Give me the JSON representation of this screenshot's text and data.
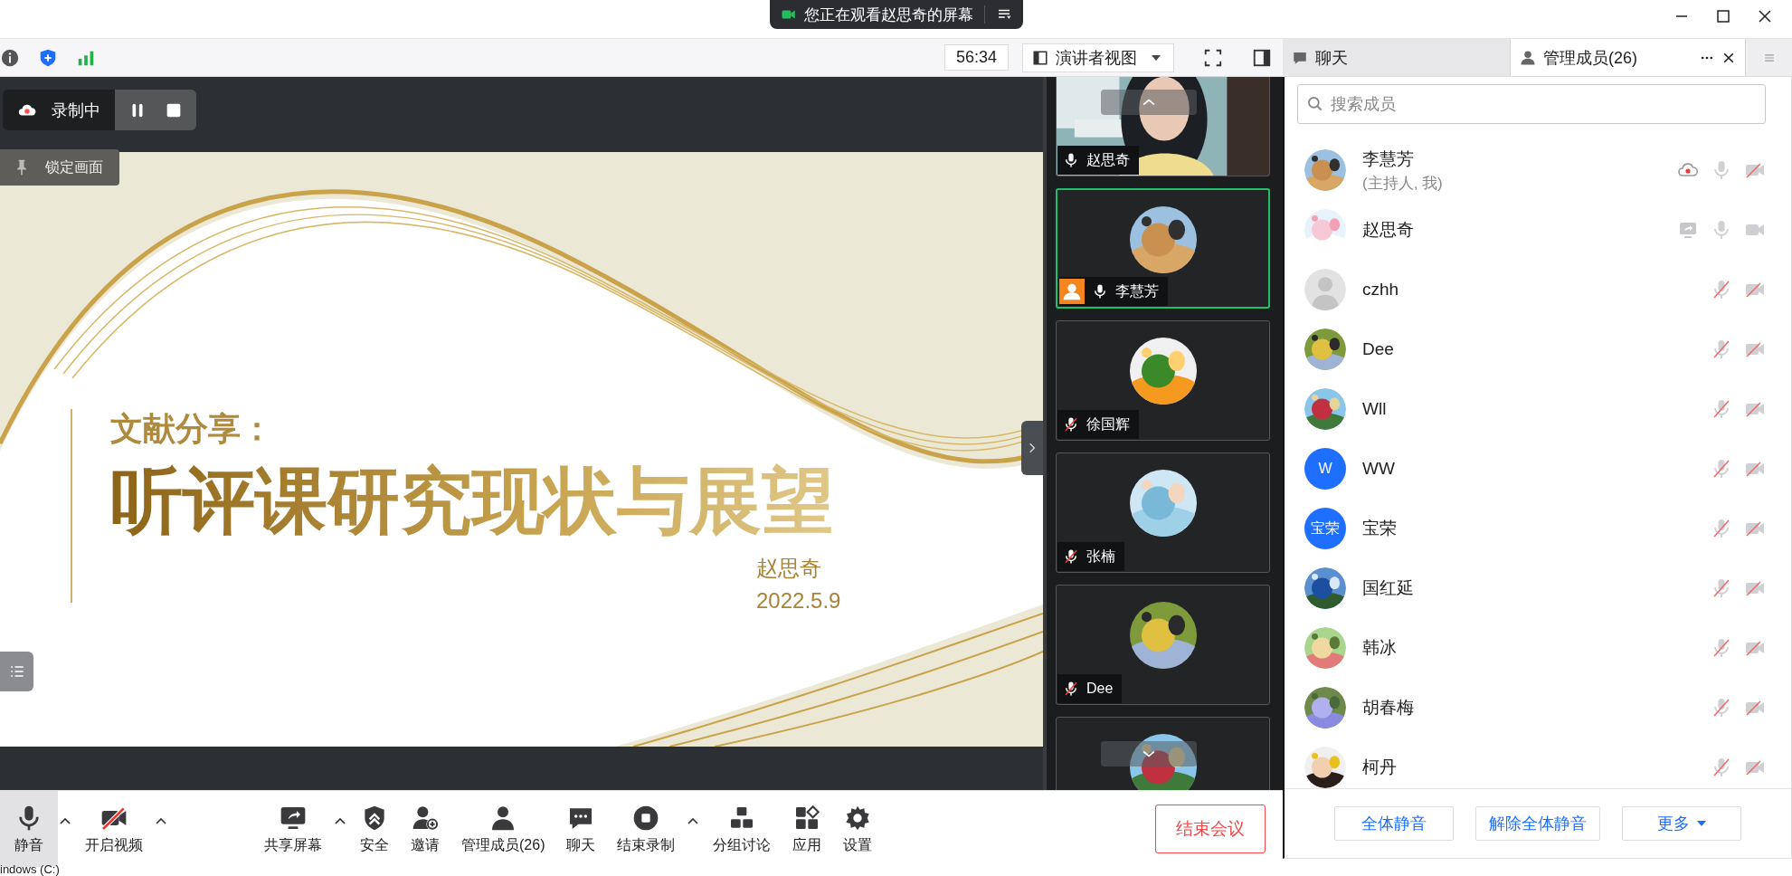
{
  "window": {
    "banner": "您正在观看赵思奇的屏幕"
  },
  "toolbar": {
    "timer": "56:34",
    "view_mode": "演讲者视图"
  },
  "side_tabs": [
    {
      "label": "聊天",
      "selected": false
    },
    {
      "label": "管理成员(26)",
      "selected": true
    }
  ],
  "recording": {
    "label": "录制中"
  },
  "lock_view": {
    "label": "锁定画面"
  },
  "slide": {
    "subtitle": "文献分享：",
    "title": "听评课研究现状与展望",
    "author": "赵思奇",
    "date": "2022.5.9"
  },
  "video_tiles": [
    {
      "kind": "camera",
      "name": "赵思奇",
      "mic_muted": false,
      "host": false,
      "selected": false
    },
    {
      "kind": "avatar",
      "name": "李慧芳",
      "mic_muted": false,
      "host": true,
      "selected": true
    },
    {
      "kind": "avatar",
      "name": "徐国辉",
      "mic_muted": true,
      "host": false,
      "selected": false
    },
    {
      "kind": "avatar",
      "name": "张楠",
      "mic_muted": true,
      "host": false,
      "selected": false
    },
    {
      "kind": "avatar",
      "name": "Dee",
      "mic_muted": true,
      "host": false,
      "selected": false
    },
    {
      "kind": "avatar",
      "selected": false
    }
  ],
  "members": {
    "search_placeholder": "搜索成员",
    "items": [
      {
        "name": "李慧芳",
        "role": "(主持人, 我)",
        "kind": "picture",
        "recording": true,
        "sharing": false,
        "mic_muted": false,
        "camera_off": true
      },
      {
        "name": "赵思奇",
        "kind": "picture",
        "recording": false,
        "sharing": true,
        "mic_muted": false,
        "camera_off": false
      },
      {
        "name": "czhh",
        "kind": "default",
        "recording": false,
        "sharing": false,
        "mic_muted": true,
        "camera_off": true
      },
      {
        "name": "Dee",
        "kind": "picture",
        "recording": false,
        "sharing": false,
        "mic_muted": true,
        "camera_off": true
      },
      {
        "name": "Wll",
        "kind": "picture",
        "recording": false,
        "sharing": false,
        "mic_muted": true,
        "camera_off": true
      },
      {
        "name": "WW",
        "kind": "initials",
        "initials": "W",
        "recording": false,
        "sharing": false,
        "mic_muted": true,
        "camera_off": true
      },
      {
        "name": "宝荣",
        "kind": "initials",
        "initials": "宝荣",
        "recording": false,
        "sharing": false,
        "mic_muted": true,
        "camera_off": true
      },
      {
        "name": "国红延",
        "kind": "picture",
        "recording": false,
        "sharing": false,
        "mic_muted": true,
        "camera_off": true
      },
      {
        "name": "韩冰",
        "kind": "picture",
        "recording": false,
        "sharing": false,
        "mic_muted": true,
        "camera_off": true
      },
      {
        "name": "胡春梅",
        "kind": "picture",
        "recording": false,
        "sharing": false,
        "mic_muted": true,
        "camera_off": true
      },
      {
        "name": "柯丹",
        "kind": "picture",
        "recording": false,
        "sharing": false,
        "mic_muted": true,
        "camera_off": true
      }
    ]
  },
  "member_actions": [
    {
      "label": "全体静音",
      "kind": "button"
    },
    {
      "label": "解除全体静音",
      "kind": "button"
    },
    {
      "label": "更多",
      "kind": "dropdown"
    }
  ],
  "bottom_toolbar": {
    "items": [
      {
        "label": "静音",
        "caret": true,
        "selected": true
      },
      {
        "label": "开启视频",
        "caret": true,
        "selected": false
      },
      {
        "label": "共享屏幕",
        "caret": true,
        "selected": false
      },
      {
        "label": "安全",
        "caret": false,
        "selected": false
      },
      {
        "label": "邀请",
        "caret": false,
        "selected": false
      },
      {
        "label": "管理成员(26)",
        "caret": false,
        "selected": false
      },
      {
        "label": "聊天",
        "caret": false,
        "selected": false
      },
      {
        "label": "结束录制",
        "caret": true,
        "selected": false
      },
      {
        "label": "分组讨论",
        "caret": false,
        "selected": false
      },
      {
        "label": "应用",
        "caret": false,
        "selected": false
      },
      {
        "label": "设置",
        "caret": false,
        "selected": false
      }
    ],
    "end_button": "结束会议"
  },
  "taskbar": {
    "text": "indows (C:)"
  }
}
